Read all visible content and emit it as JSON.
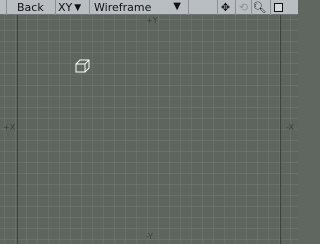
{
  "toolbar": {
    "view_label": "Back",
    "axis_label": "XY",
    "mode_label": "Wireframe",
    "tools": [
      "move-icon",
      "rotate-icon",
      "zoom-icon",
      "maximize-icon"
    ]
  },
  "viewport": {
    "axis_markers": {
      "top": "+Y",
      "bottom": "-Y",
      "left": "+X",
      "right": "-X"
    },
    "object_icon": "cube-icon"
  },
  "colors": {
    "viewport_bg": "#5f6760",
    "toolbar_bg": "#b9bec3",
    "object": "#ffffff"
  }
}
